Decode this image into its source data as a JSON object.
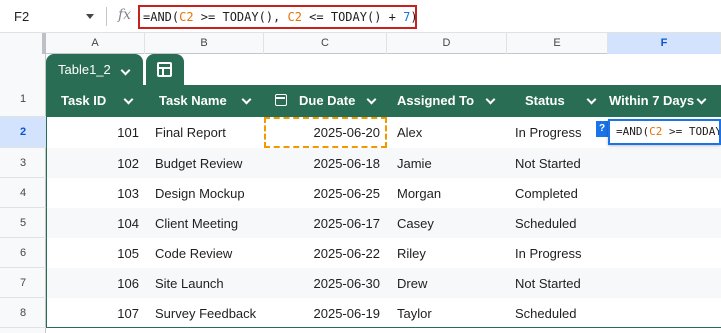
{
  "formula_bar": {
    "cell_ref": "F2",
    "fx": "fx",
    "formula_parts": [
      {
        "text": "=AND(",
        "color": "default"
      },
      {
        "text": "C2",
        "color": "orange"
      },
      {
        "text": " >= TODAY(), ",
        "color": "default"
      },
      {
        "text": "C2",
        "color": "orange"
      },
      {
        "text": " <= TODAY() + ",
        "color": "default"
      },
      {
        "text": "7",
        "color": "blue"
      },
      {
        "text": ")",
        "color": "default"
      }
    ]
  },
  "columns": [
    "A",
    "B",
    "C",
    "D",
    "E",
    "F"
  ],
  "selected_column": "F",
  "row_numbers": [
    "1",
    "2",
    "3",
    "4",
    "5",
    "6",
    "7",
    "8"
  ],
  "selected_row": "2",
  "table": {
    "name": "Table1_2",
    "headers": [
      "Task ID",
      "Task Name",
      "Due Date",
      "Assigned To",
      "Status",
      "Within 7 Days"
    ],
    "rows": [
      [
        "101",
        "Final Report",
        "2025-06-20",
        "Alex",
        "In Progress"
      ],
      [
        "102",
        "Budget Review",
        "2025-06-18",
        "Jamie",
        "Not Started"
      ],
      [
        "103",
        "Design Mockup",
        "2025-06-25",
        "Morgan",
        "Completed"
      ],
      [
        "104",
        "Client Meeting",
        "2025-06-17",
        "Casey",
        "Scheduled"
      ],
      [
        "105",
        "Code Review",
        "2025-06-22",
        "Riley",
        "In Progress"
      ],
      [
        "106",
        "Site Launch",
        "2025-06-30",
        "Drew",
        "Not Started"
      ],
      [
        "107",
        "Survey Feedback",
        "2025-06-19",
        "Taylor",
        "Scheduled"
      ]
    ]
  },
  "edit_popup": {
    "help_mark": "?",
    "formula_parts": [
      {
        "text": "=AND(",
        "color": "default"
      },
      {
        "text": "C2",
        "color": "orange"
      },
      {
        "text": " >= TODAY",
        "color": "default"
      }
    ]
  },
  "colors": {
    "table_header_bg": "#296e54",
    "selection_blue": "#1a73e8",
    "formula_border": "#c5221f",
    "ref_orange": "#e8710a",
    "active_cell_border": "#f29900"
  }
}
